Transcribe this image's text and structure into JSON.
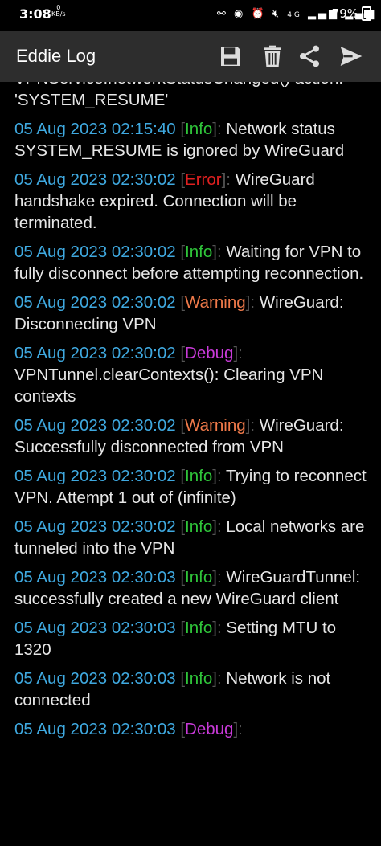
{
  "status_bar": {
    "time": "3:08",
    "net_speed": "0",
    "net_unit": "KB/s",
    "signal": "4G",
    "battery": "79%"
  },
  "toolbar": {
    "title": "Eddie Log",
    "save_icon": "save-icon",
    "delete_icon": "trash-icon",
    "share_icon": "share-icon",
    "send_icon": "send-icon"
  },
  "colors": {
    "timestamp": "#3fa9e0",
    "info": "#2fc43a",
    "error": "#e02020",
    "warning": "#f07a4a",
    "debug": "#c83ad8",
    "toolbar_bg": "#2d2d2d"
  },
  "log": {
    "partial_top": "VPNService.networkStatusChanged() action: 'SYSTEM_RESUME'",
    "entries": [
      {
        "ts": "05 Aug 2023 02:15:40",
        "level": "Info",
        "msg": "Network status SYSTEM_RESUME is ignored by WireGuard"
      },
      {
        "ts": "05 Aug 2023 02:30:02",
        "level": "Error",
        "msg": "WireGuard handshake expired. Connection will be terminated."
      },
      {
        "ts": "05 Aug 2023 02:30:02",
        "level": "Info",
        "msg": "Waiting for VPN to fully disconnect before attempting reconnection."
      },
      {
        "ts": "05 Aug 2023 02:30:02",
        "level": "Warning",
        "msg": "WireGuard: Disconnecting VPN"
      },
      {
        "ts": "05 Aug 2023 02:30:02",
        "level": "Debug",
        "msg": "VPNTunnel.clearContexts(): Clearing VPN contexts"
      },
      {
        "ts": "05 Aug 2023 02:30:02",
        "level": "Warning",
        "msg": "WireGuard: Successfully disconnected from VPN"
      },
      {
        "ts": "05 Aug 2023 02:30:02",
        "level": "Info",
        "msg": "Trying to reconnect VPN. Attempt 1 out of (infinite)"
      },
      {
        "ts": "05 Aug 2023 02:30:02",
        "level": "Info",
        "msg": "Local networks are tunneled into the VPN"
      },
      {
        "ts": "05 Aug 2023 02:30:03",
        "level": "Info",
        "msg": "WireGuardTunnel: successfully created a new WireGuard client"
      },
      {
        "ts": "05 Aug 2023 02:30:03",
        "level": "Info",
        "msg": "Setting MTU to 1320"
      },
      {
        "ts": "05 Aug 2023 02:30:03",
        "level": "Info",
        "msg": "Network is not connected"
      },
      {
        "ts": "05 Aug 2023 02:30:03",
        "level": "Debug",
        "msg": ""
      }
    ]
  }
}
